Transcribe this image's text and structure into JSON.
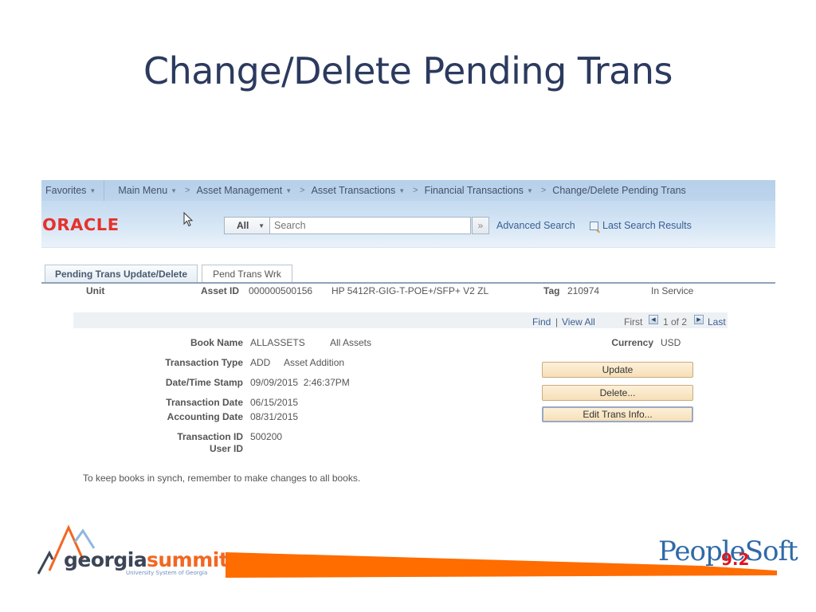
{
  "slide": {
    "title": "Change/Delete Pending Trans"
  },
  "navbar": {
    "favorites": "Favorites",
    "breadcrumbs": [
      {
        "label": "Main Menu"
      },
      {
        "label": "Asset Management"
      },
      {
        "label": "Asset Transactions"
      },
      {
        "label": "Financial Transactions"
      },
      {
        "label": "Change/Delete Pending Trans"
      }
    ]
  },
  "header": {
    "logo": "ORACLE",
    "search_scope": "All",
    "search_placeholder": "Search",
    "search_go": "»",
    "advanced_search": "Advanced Search",
    "last_search_results": "Last Search Results"
  },
  "tabs": [
    {
      "label": "Pending Trans Update/Delete",
      "active": true
    },
    {
      "label": "Pend Trans Wrk",
      "active": false
    }
  ],
  "asset_header": {
    "unit_label": "Unit",
    "unit_value": "",
    "asset_id_label": "Asset ID",
    "asset_id_value": "000000500156",
    "asset_description": "HP 5412R-GIG-T-POE+/SFP+ V2 ZL",
    "tag_label": "Tag",
    "tag_value": "210974",
    "status": "In Service"
  },
  "pager": {
    "find": "Find",
    "separator": "|",
    "view_all": "View All",
    "first": "First",
    "position": "1 of 2",
    "last": "Last"
  },
  "details": {
    "book_name_label": "Book Name",
    "book_name_value": "ALLASSETS",
    "book_name_desc": "All Assets",
    "currency_label": "Currency",
    "currency_value": "USD",
    "transaction_type_label": "Transaction Type",
    "transaction_type_value": "ADD",
    "transaction_type_desc": "Asset Addition",
    "datetime_label": "Date/Time Stamp",
    "datetime_value": "09/09/2015  2:46:37PM",
    "transaction_date_label": "Transaction Date",
    "transaction_date_value": "06/15/2015",
    "accounting_date_label": "Accounting Date",
    "accounting_date_value": "08/31/2015",
    "transaction_id_label": "Transaction ID",
    "transaction_id_value": "500200",
    "user_id_label": "User ID",
    "user_id_value": ""
  },
  "buttons": {
    "update": "Update",
    "delete": "Delete...",
    "edit_trans_info": "Edit Trans Info..."
  },
  "note": "To keep books in synch, remember to make changes to all books.",
  "footer": {
    "usg_logo_word1": "georgia",
    "usg_logo_word2": "summit",
    "usg_logo_sub": "University System of Georgia",
    "peoplesoft": "PeopleSoft",
    "peoplesoft_version": "9.2",
    "accent_color": "#ff6c00",
    "navy_color": "#2b3a5e"
  }
}
